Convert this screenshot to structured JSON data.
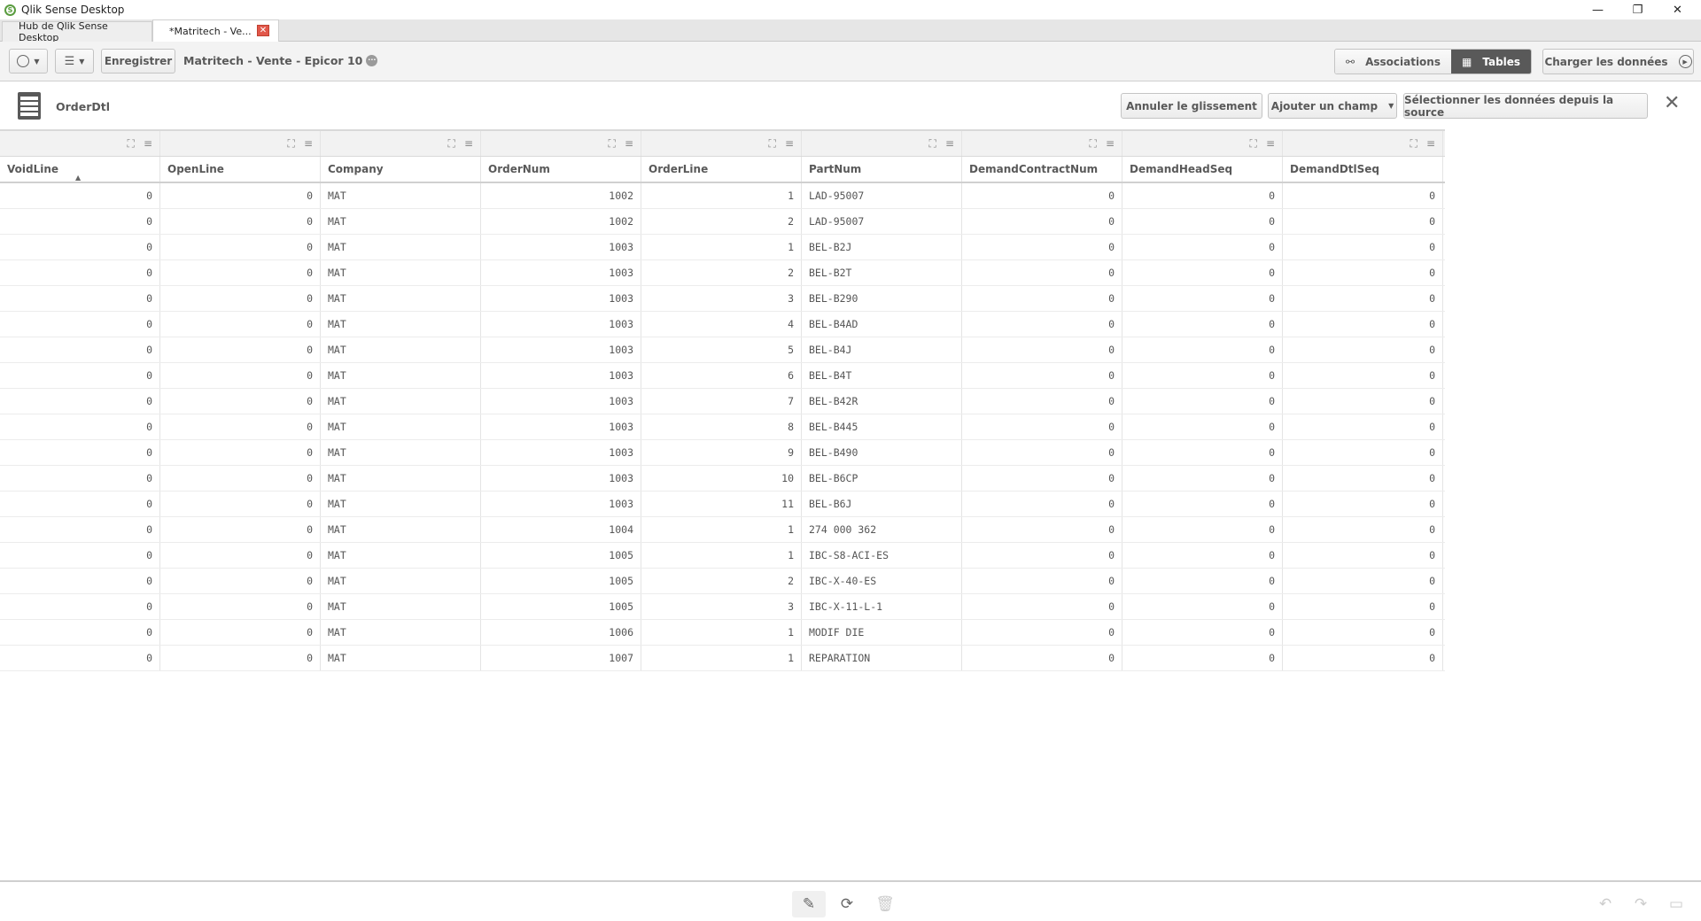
{
  "window": {
    "title": "Qlik Sense Desktop",
    "minimize": "—",
    "restore": "❐",
    "close": "✕"
  },
  "tabs": [
    {
      "label": "Hub de Qlik Sense Desktop"
    },
    {
      "label": "*Matritech - Ve...",
      "close": "✕"
    }
  ],
  "toolbar": {
    "save_label": "Enregistrer",
    "app_title": "Matritech - Vente - Epicor 10",
    "more": "···",
    "associations_label": "Associations",
    "tables_label": "Tables",
    "load_label": "Charger les données"
  },
  "table_bar": {
    "table_name": "OrderDtl",
    "undo_drag_label": "Annuler le glissement",
    "add_field_label": "Ajouter un champ",
    "select_source_label": "Sélectionner les données depuis la source"
  },
  "columns": [
    "VoidLine",
    "OpenLine",
    "Company",
    "OrderNum",
    "OrderLine",
    "PartNum",
    "DemandContractNum",
    "DemandHeadSeq",
    "DemandDtlSeq"
  ],
  "rows": [
    [
      "0",
      "0",
      "MAT",
      "1002",
      "1",
      "LAD-95007",
      "0",
      "0",
      "0"
    ],
    [
      "0",
      "0",
      "MAT",
      "1002",
      "2",
      "LAD-95007",
      "0",
      "0",
      "0"
    ],
    [
      "0",
      "0",
      "MAT",
      "1003",
      "1",
      "BEL-B2J",
      "0",
      "0",
      "0"
    ],
    [
      "0",
      "0",
      "MAT",
      "1003",
      "2",
      "BEL-B2T",
      "0",
      "0",
      "0"
    ],
    [
      "0",
      "0",
      "MAT",
      "1003",
      "3",
      "BEL-B290",
      "0",
      "0",
      "0"
    ],
    [
      "0",
      "0",
      "MAT",
      "1003",
      "4",
      "BEL-B4AD",
      "0",
      "0",
      "0"
    ],
    [
      "0",
      "0",
      "MAT",
      "1003",
      "5",
      "BEL-B4J",
      "0",
      "0",
      "0"
    ],
    [
      "0",
      "0",
      "MAT",
      "1003",
      "6",
      "BEL-B4T",
      "0",
      "0",
      "0"
    ],
    [
      "0",
      "0",
      "MAT",
      "1003",
      "7",
      "BEL-B42R",
      "0",
      "0",
      "0"
    ],
    [
      "0",
      "0",
      "MAT",
      "1003",
      "8",
      "BEL-B445",
      "0",
      "0",
      "0"
    ],
    [
      "0",
      "0",
      "MAT",
      "1003",
      "9",
      "BEL-B490",
      "0",
      "0",
      "0"
    ],
    [
      "0",
      "0",
      "MAT",
      "1003",
      "10",
      "BEL-B6CP",
      "0",
      "0",
      "0"
    ],
    [
      "0",
      "0",
      "MAT",
      "1003",
      "11",
      "BEL-B6J",
      "0",
      "0",
      "0"
    ],
    [
      "0",
      "0",
      "MAT",
      "1004",
      "1",
      "274 000 362",
      "0",
      "0",
      "0"
    ],
    [
      "0",
      "0",
      "MAT",
      "1005",
      "1",
      "IBC-S8-ACI-ES",
      "0",
      "0",
      "0"
    ],
    [
      "0",
      "0",
      "MAT",
      "1005",
      "2",
      "IBC-X-40-ES",
      "0",
      "0",
      "0"
    ],
    [
      "0",
      "0",
      "MAT",
      "1005",
      "3",
      "IBC-X-11-L-1",
      "0",
      "0",
      "0"
    ],
    [
      "0",
      "0",
      "MAT",
      "1006",
      "1",
      "MODIF DIE",
      "0",
      "0",
      "0"
    ],
    [
      "0",
      "0",
      "MAT",
      "1007",
      "1",
      "REPARATION",
      "0",
      "0",
      "0"
    ]
  ],
  "numeric_columns": [
    0,
    1,
    3,
    4,
    6,
    7,
    8
  ],
  "colors": {
    "active_segment": "#595959",
    "tab_close": "#e1574a"
  }
}
